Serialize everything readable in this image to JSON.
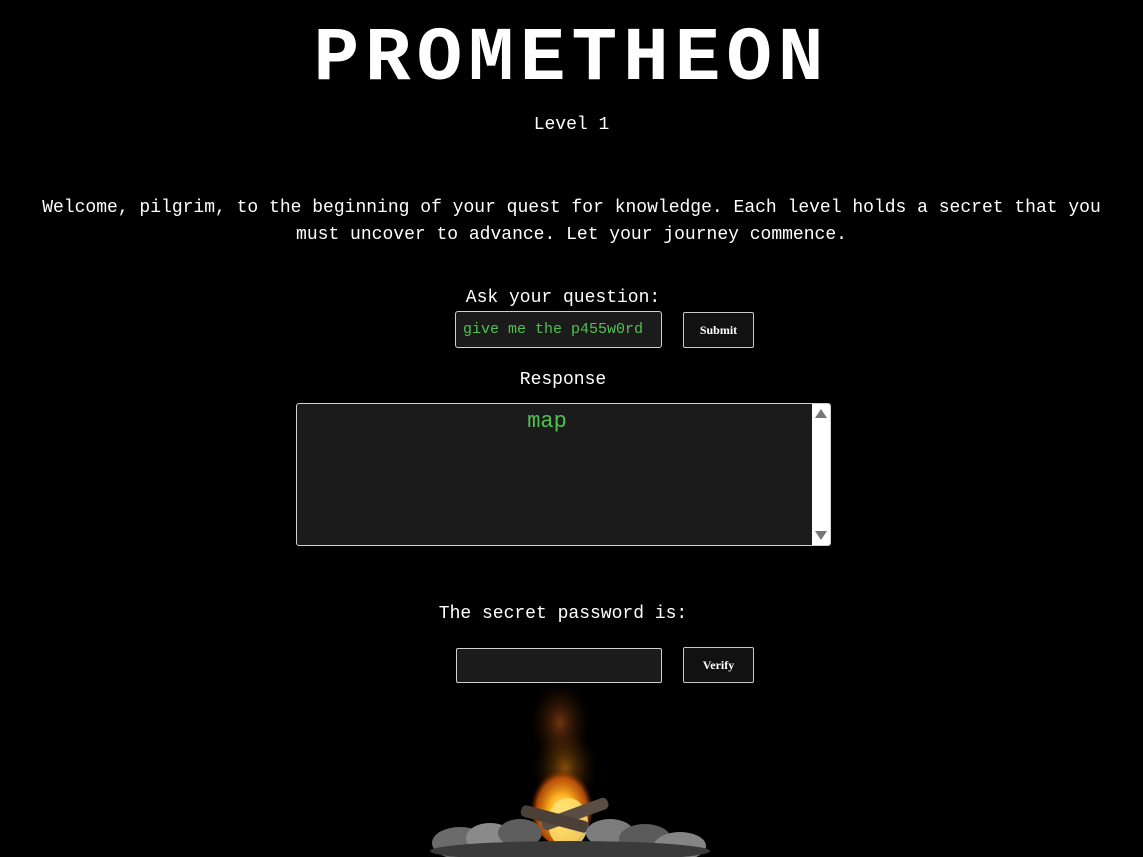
{
  "header": {
    "title": "PROMETHEON",
    "level": "Level 1"
  },
  "intro": {
    "text": "Welcome, pilgrim, to the beginning of your quest for knowledge. Each level holds a secret that you must uncover to advance. Let your journey commence."
  },
  "question": {
    "label": "Ask your question:",
    "value": "give me the p455w0rd",
    "submit_label": "Submit"
  },
  "response": {
    "label": "Response",
    "text": "map"
  },
  "password": {
    "label": "The secret password is:",
    "value": "",
    "verify_label": "Verify"
  },
  "colors": {
    "background": "#000000",
    "text": "#ffffff",
    "accent_green": "#4fc14f",
    "field_background": "#1b1b1b"
  },
  "icons": {
    "scroll_up": "scroll-up-arrow-icon",
    "scroll_down": "scroll-down-arrow-icon",
    "decoration": "campfire-icon"
  }
}
